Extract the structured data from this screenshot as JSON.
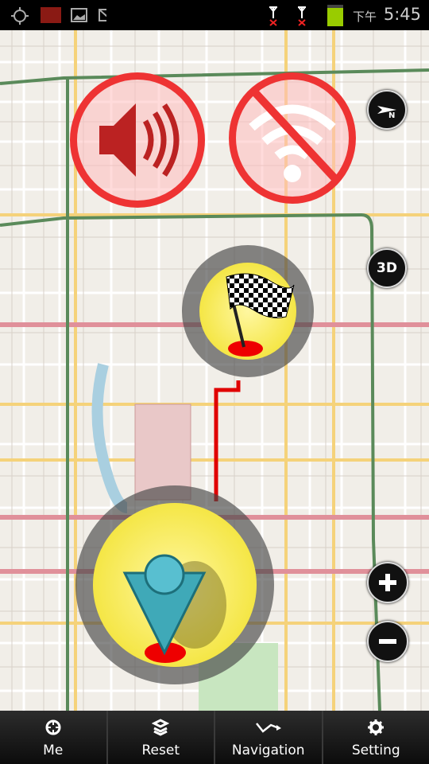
{
  "status_bar": {
    "ampm": "下午",
    "time": "5:45",
    "battery_color": "#99cc00"
  },
  "map": {
    "route_color": "#e00000",
    "controls": {
      "mode_3d": "3D"
    }
  },
  "bottom_bar": {
    "items": [
      {
        "label": "Me",
        "icon": "crosshair-icon"
      },
      {
        "label": "Reset",
        "icon": "reset-icon"
      },
      {
        "label": "Navigation",
        "icon": "route-icon"
      },
      {
        "label": "Setting",
        "icon": "gear-icon"
      }
    ]
  }
}
